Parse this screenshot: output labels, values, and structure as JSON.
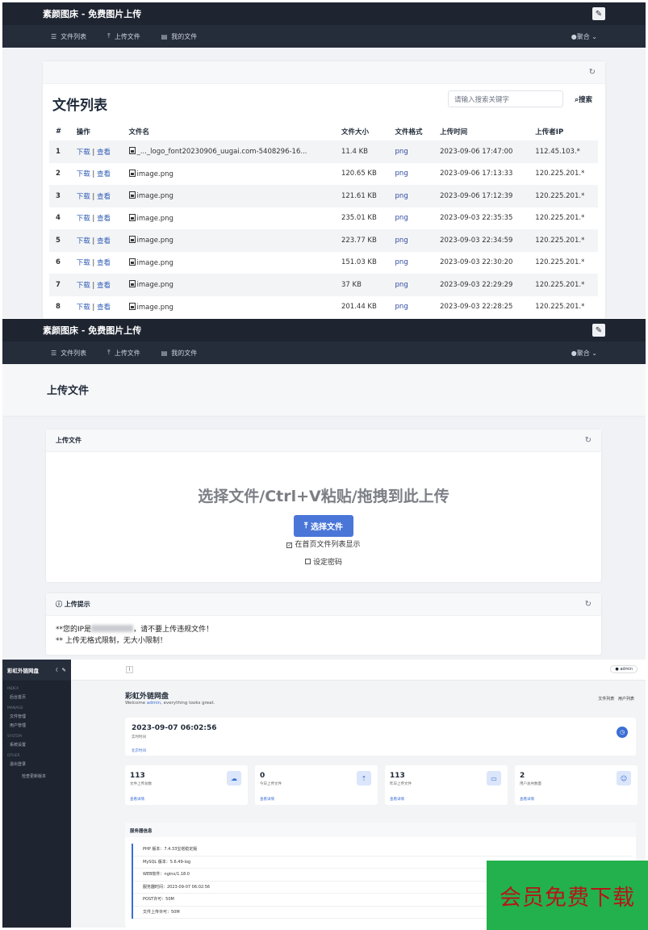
{
  "app": {
    "brand": "素颜图床 - 免费图片上传",
    "nav": [
      "文件列表",
      "上传文件",
      "我的文件"
    ],
    "user": "聚合"
  },
  "list": {
    "title": "文件列表",
    "search_placeholder": "请输入搜索关键字",
    "search_btn": "搜索",
    "headers": [
      "#",
      "操作",
      "文件名",
      "文件大小",
      "文件格式",
      "上传时间",
      "上传者IP"
    ],
    "action_download": "下载",
    "action_sep": "|",
    "action_view": "查看",
    "rows": [
      {
        "n": "1",
        "name": "_..._logo_font20230906_uugai.com-5408296-16...",
        "size": "11.4 KB",
        "fmt": "png",
        "time": "2023-09-06 17:47:00",
        "ip": "112.45.103.*"
      },
      {
        "n": "2",
        "name": "image.png",
        "size": "120.65 KB",
        "fmt": "png",
        "time": "2023-09-06 17:13:33",
        "ip": "120.225.201.*"
      },
      {
        "n": "3",
        "name": "image.png",
        "size": "121.61 KB",
        "fmt": "png",
        "time": "2023-09-06 17:12:39",
        "ip": "120.225.201.*"
      },
      {
        "n": "4",
        "name": "image.png",
        "size": "235.01 KB",
        "fmt": "png",
        "time": "2023-09-03 22:35:35",
        "ip": "120.225.201.*"
      },
      {
        "n": "5",
        "name": "image.png",
        "size": "223.77 KB",
        "fmt": "png",
        "time": "2023-09-03 22:34:59",
        "ip": "120.225.201.*"
      },
      {
        "n": "6",
        "name": "image.png",
        "size": "151.03 KB",
        "fmt": "png",
        "time": "2023-09-03 22:30:20",
        "ip": "120.225.201.*"
      },
      {
        "n": "7",
        "name": "image.png",
        "size": "37 KB",
        "fmt": "png",
        "time": "2023-09-03 22:29:29",
        "ip": "120.225.201.*"
      },
      {
        "n": "8",
        "name": "image.png",
        "size": "201.44 KB",
        "fmt": "png",
        "time": "2023-09-03 22:28:25",
        "ip": "120.225.201.*"
      }
    ]
  },
  "upload": {
    "page_title": "上传文件",
    "card_title": "上传文件",
    "drop_text": "选择文件/Ctrl+V粘贴/拖拽到此上传",
    "btn": "选择文件",
    "chk1": "在首页文件列表显示",
    "chk2": "设定密码",
    "tips_title": "上传提示",
    "tip1_a": "**您的IP是",
    "tip1_b": "，请不要上传违规文件！",
    "tip2": "** 上传无格式限制，无大小限制！"
  },
  "admin": {
    "brand": "彩虹外链网盘",
    "sec_index": "INDEX",
    "item_home": "后台首页",
    "sec_manage": "MANAGE",
    "item_files": "文件管理",
    "item_users": "用户管理",
    "sec_system": "SYSTEM",
    "item_settings": "系统设置",
    "sec_other": "OTHER",
    "item_logout": "退出登录",
    "item_update": "检查更新版本",
    "topbar_user": "admin",
    "title": "彩虹外链网盘",
    "welcome_pre": "Welcome ",
    "welcome_user": "admin",
    "welcome_post": ", everything looks great.",
    "link_files": "文件列表",
    "link_users": "用户列表",
    "time": "2023-09-07 06:02:56",
    "time_label": "实时时间",
    "time_link": "北京时间",
    "stats": [
      {
        "v": "113",
        "l": "文件上传总数",
        "d": "查看详情"
      },
      {
        "v": "0",
        "l": "今日上传文件",
        "d": "查看详情"
      },
      {
        "v": "113",
        "l": "昨日上传文件",
        "d": "查看详情"
      },
      {
        "v": "2",
        "l": "用户总共数量",
        "d": "查看详情"
      }
    ],
    "server_title": "服务器信息",
    "server": [
      "PHP 版本：7.4.33宝塔稳定版",
      "MySQL 版本：5.6.49-log",
      "WEB软件：nginx/1.18.0",
      "服务器时间：2023-09-07 06:02:56",
      "POST许可：50M",
      "文件上传许可：50M"
    ]
  },
  "watermark": "会员免费下载"
}
